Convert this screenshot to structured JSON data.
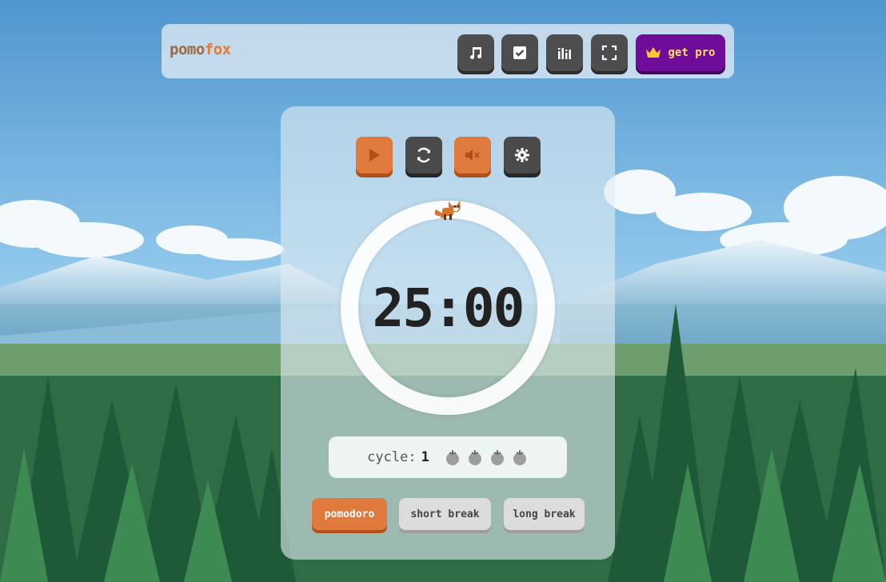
{
  "brand": {
    "part1": "pomo",
    "part2": "fox"
  },
  "toolbar": {
    "music_icon": "music-note-icon",
    "tasks_icon": "checkbox-icon",
    "stats_icon": "equalizer-icon",
    "fullscreen_icon": "fullscreen-icon",
    "pro_label": "get pro",
    "pro_icon": "crown-icon"
  },
  "timer": {
    "time": "25:00",
    "controls": [
      "play-icon",
      "reset-icon",
      "mute-icon",
      "settings-icon"
    ]
  },
  "cycle": {
    "label": "cycle:",
    "value": "1",
    "tomatoes": 4
  },
  "modes": [
    {
      "label": "pomodoro",
      "active": true
    },
    {
      "label": "short break",
      "active": false
    },
    {
      "label": "long break",
      "active": false
    }
  ],
  "colors": {
    "accent": "#e07a3c",
    "pro": "#6f0c9a",
    "dark_button": "#4a4a4a"
  }
}
